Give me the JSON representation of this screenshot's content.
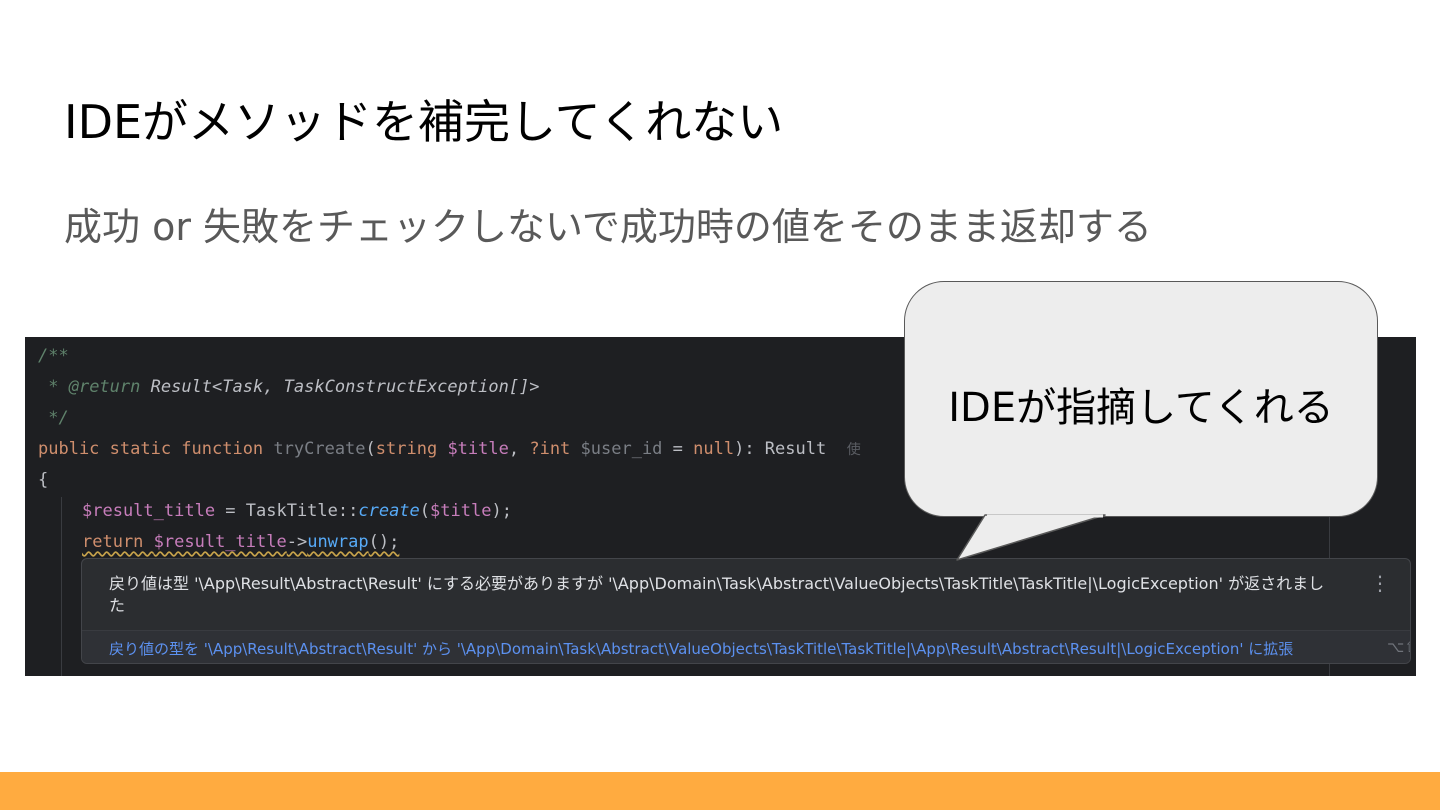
{
  "slide": {
    "title": "IDEがメソッドを補完してくれない",
    "subtitle": "成功 or 失敗をチェックしないで成功時の値をそのまま返却する",
    "accent_bar_color": "#ffab40"
  },
  "code": {
    "line1": "/**",
    "line2_star": " * ",
    "line2_tag": "@return",
    "line2_type": " Result<Task, TaskConstructException[]>",
    "line3": " */",
    "line4_kw": "public static function ",
    "line4_fn": "tryCreate",
    "line4_paren": "(",
    "line4_type1": "string ",
    "line4_var1": "$title",
    "line4_sep": ", ",
    "line4_type2": "?int ",
    "line4_var2": "$user_id",
    "line4_eq": " = ",
    "line4_null": "null",
    "line4_ret": "): Result",
    "line4_hint": "使",
    "line5": "{",
    "line6_var": "$result_title",
    "line6_eq": " = TaskTitle::",
    "line6_call": "create",
    "line6_open": "(",
    "line6_arg": "$title",
    "line6_close": ");",
    "line7_kw": "return ",
    "line7_var": "$result_title",
    "line7_arrow": "->",
    "line7_call": "unwrap",
    "line7_end": "();"
  },
  "inspection": {
    "message": "戻り値は型 '\\App\\Result\\Abstract\\Result' にする必要がありますが '\\App\\Domain\\Task\\Abstract\\ValueObjects\\TaskTitle\\TaskTitle|\\LogicException' が返されました",
    "quick_fix": "戻り値の型を '\\App\\Result\\Abstract\\Result' から '\\App\\Domain\\Task\\Abstract\\ValueObjects\\TaskTitle\\TaskTitle|\\App\\Result\\Abstract\\Result|\\LogicException' に拡張",
    "shortcut": "⌥⇧",
    "menu_icon": "vertical-ellipsis-icon"
  },
  "callout": {
    "text": "IDEが指摘してくれる"
  }
}
